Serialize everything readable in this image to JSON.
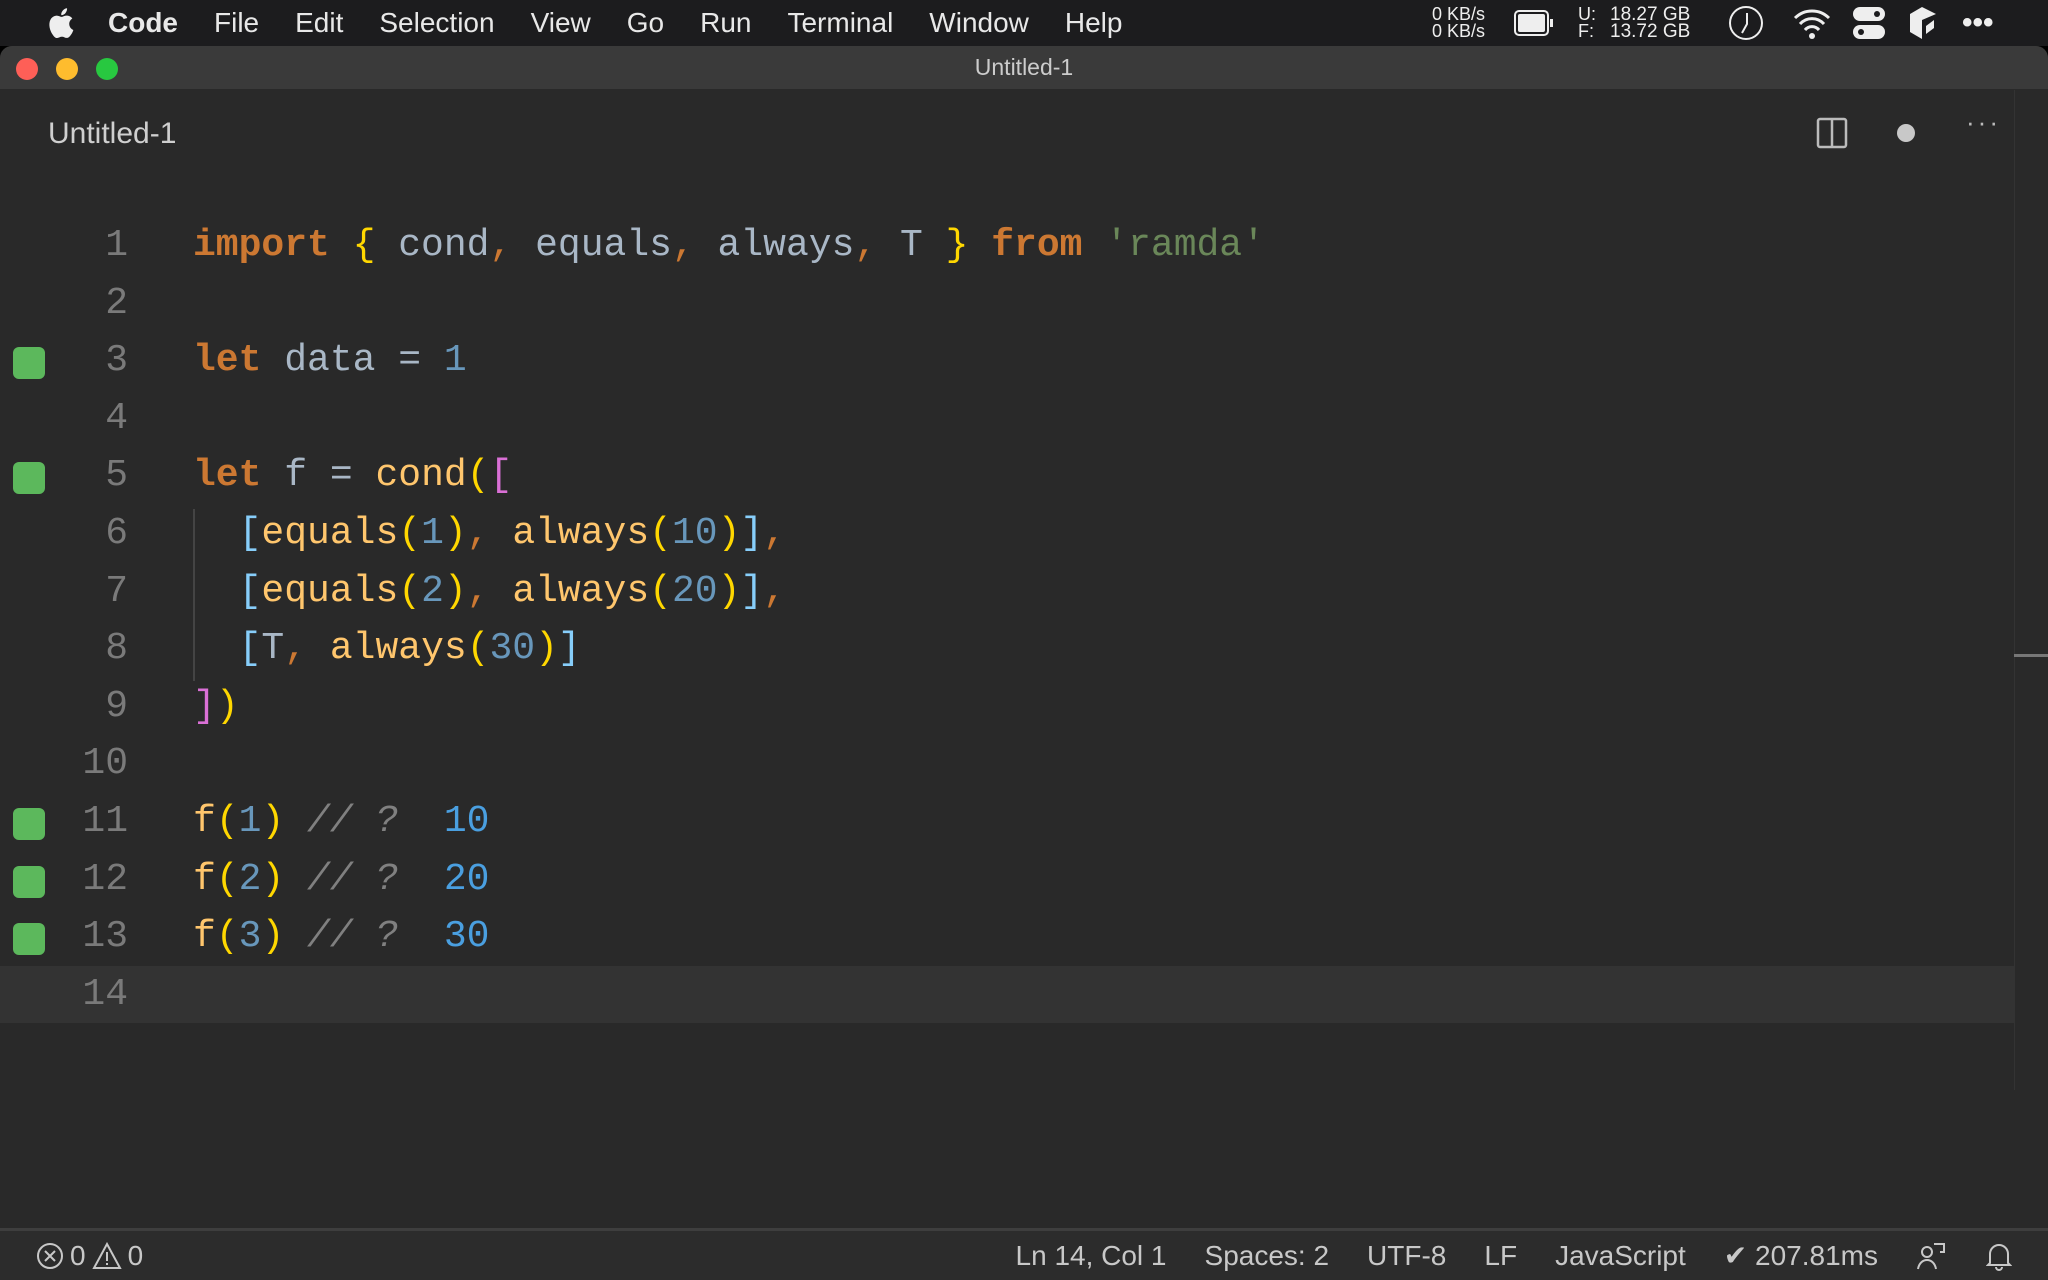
{
  "menubar": {
    "app": "Code",
    "items": [
      "File",
      "Edit",
      "Selection",
      "View",
      "Go",
      "Run",
      "Terminal",
      "Window",
      "Help"
    ],
    "net_up": "0 KB/s",
    "net_down": "0 KB/s",
    "mem_used_label": "U:",
    "mem_used": "18.27 GB",
    "mem_free_label": "F:",
    "mem_free": "13.72 GB"
  },
  "window": {
    "title": "Untitled-1"
  },
  "tab": {
    "title": "Untitled-1"
  },
  "editor": {
    "current_line": 14,
    "lines": [
      {
        "n": "1",
        "gutter": false,
        "tokens": [
          [
            "kw",
            "import"
          ],
          [
            "id",
            " "
          ],
          [
            "br1",
            "{"
          ],
          [
            "id",
            " cond"
          ],
          [
            "pun",
            ","
          ],
          [
            "id",
            " equals"
          ],
          [
            "pun",
            ","
          ],
          [
            "id",
            " always"
          ],
          [
            "pun",
            ","
          ],
          [
            "id",
            " T "
          ],
          [
            "br1",
            "}"
          ],
          [
            "id",
            " "
          ],
          [
            "kw",
            "from"
          ],
          [
            "id",
            " "
          ],
          [
            "str",
            "'ramda'"
          ]
        ]
      },
      {
        "n": "2",
        "gutter": false,
        "tokens": []
      },
      {
        "n": "3",
        "gutter": true,
        "tokens": [
          [
            "kw",
            "let"
          ],
          [
            "id",
            " data "
          ],
          [
            "op",
            "="
          ],
          [
            "id",
            " "
          ],
          [
            "num",
            "1"
          ]
        ]
      },
      {
        "n": "4",
        "gutter": false,
        "tokens": []
      },
      {
        "n": "5",
        "gutter": true,
        "tokens": [
          [
            "kw",
            "let"
          ],
          [
            "id",
            " f "
          ],
          [
            "op",
            "="
          ],
          [
            "id",
            " "
          ],
          [
            "fn",
            "cond"
          ],
          [
            "br1",
            "("
          ],
          [
            "br2",
            "["
          ]
        ]
      },
      {
        "n": "6",
        "gutter": false,
        "tokens": [
          [
            "id",
            "  "
          ],
          [
            "br3",
            "["
          ],
          [
            "fn",
            "equals"
          ],
          [
            "br1",
            "("
          ],
          [
            "num",
            "1"
          ],
          [
            "br1",
            ")"
          ],
          [
            "pun",
            ","
          ],
          [
            "id",
            " "
          ],
          [
            "fn",
            "always"
          ],
          [
            "br1",
            "("
          ],
          [
            "num",
            "10"
          ],
          [
            "br1",
            ")"
          ],
          [
            "br3",
            "]"
          ],
          [
            "pun",
            ","
          ]
        ]
      },
      {
        "n": "7",
        "gutter": false,
        "tokens": [
          [
            "id",
            "  "
          ],
          [
            "br3",
            "["
          ],
          [
            "fn",
            "equals"
          ],
          [
            "br1",
            "("
          ],
          [
            "num",
            "2"
          ],
          [
            "br1",
            ")"
          ],
          [
            "pun",
            ","
          ],
          [
            "id",
            " "
          ],
          [
            "fn",
            "always"
          ],
          [
            "br1",
            "("
          ],
          [
            "num",
            "20"
          ],
          [
            "br1",
            ")"
          ],
          [
            "br3",
            "]"
          ],
          [
            "pun",
            ","
          ]
        ]
      },
      {
        "n": "8",
        "gutter": false,
        "tokens": [
          [
            "id",
            "  "
          ],
          [
            "br3",
            "["
          ],
          [
            "id",
            "T"
          ],
          [
            "pun",
            ","
          ],
          [
            "id",
            " "
          ],
          [
            "fn",
            "always"
          ],
          [
            "br1",
            "("
          ],
          [
            "num",
            "30"
          ],
          [
            "br1",
            ")"
          ],
          [
            "br3",
            "]"
          ]
        ]
      },
      {
        "n": "9",
        "gutter": false,
        "tokens": [
          [
            "br2",
            "]"
          ],
          [
            "br1",
            ")"
          ]
        ]
      },
      {
        "n": "10",
        "gutter": false,
        "tokens": []
      },
      {
        "n": "11",
        "gutter": true,
        "tokens": [
          [
            "fn",
            "f"
          ],
          [
            "br1",
            "("
          ],
          [
            "num",
            "1"
          ],
          [
            "br1",
            ")"
          ],
          [
            "cm",
            " // ? "
          ],
          [
            "res",
            " 10"
          ]
        ]
      },
      {
        "n": "12",
        "gutter": true,
        "tokens": [
          [
            "fn",
            "f"
          ],
          [
            "br1",
            "("
          ],
          [
            "num",
            "2"
          ],
          [
            "br1",
            ")"
          ],
          [
            "cm",
            " // ? "
          ],
          [
            "res",
            " 20"
          ]
        ]
      },
      {
        "n": "13",
        "gutter": true,
        "tokens": [
          [
            "fn",
            "f"
          ],
          [
            "br1",
            "("
          ],
          [
            "num",
            "3"
          ],
          [
            "br1",
            ")"
          ],
          [
            "cm",
            " // ? "
          ],
          [
            "res",
            " 30"
          ]
        ]
      },
      {
        "n": "14",
        "gutter": false,
        "tokens": []
      }
    ]
  },
  "statusbar": {
    "errors": "0",
    "warnings": "0",
    "position": "Ln 14, Col 1",
    "spaces": "Spaces: 2",
    "encoding": "UTF-8",
    "eol": "LF",
    "language": "JavaScript",
    "timing": "✔ 207.81ms"
  },
  "colors": {
    "gutter_marker": "#5cb85c",
    "keyword": "#cc7832",
    "function": "#ffc66d",
    "number": "#6897bb",
    "string": "#6a8759"
  }
}
